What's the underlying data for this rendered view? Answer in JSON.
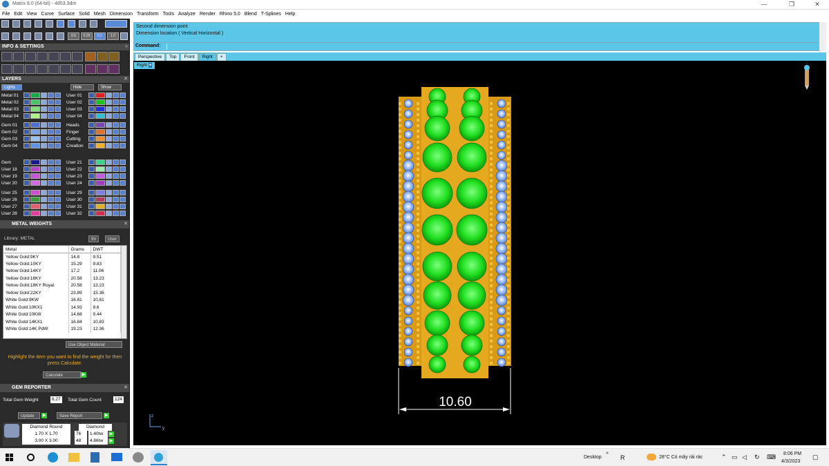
{
  "window": {
    "title": "Matrix 8.0 (64-bit) - 4853.3dm",
    "min_glyph": "—",
    "max_glyph": "❐",
    "close_glyph": "✕"
  },
  "menu": [
    "File",
    "Edit",
    "View",
    "Curve",
    "Surface",
    "Solid",
    "Mesh",
    "Dimension",
    "Transform",
    "Tools",
    "Analyze",
    "Render",
    "Rhino 5.0",
    "Blend",
    "T-Splines",
    "Help"
  ],
  "toolbar": {
    "values": [
      "0.5",
      "0.25",
      "0.1",
      "1.0"
    ]
  },
  "info": {
    "title": "INFO & SETTINGS"
  },
  "layers": {
    "title": "LAYERS",
    "lights_label": "Lights",
    "hide_label": "Hide",
    "show_label": "Show",
    "rows_left": [
      "Metal 01",
      "Metal 02",
      "Metal 03",
      "Metal 04",
      "Gem 01",
      "Gem 02",
      "Gem 03",
      "Gem 04",
      "Gem",
      "User 18",
      "User 19",
      "User 20",
      "User 25",
      "User 26",
      "User 27",
      "User 28"
    ],
    "rows_right": [
      "User 01",
      "User 02",
      "User 03",
      "User 04",
      "Heads",
      "Finger",
      "Cutting",
      "Creation",
      "User 21",
      "User 22",
      "User 23",
      "User 24",
      "User 29",
      "User 30",
      "User 31",
      "User 32"
    ],
    "colors_left": [
      "#18a94b",
      "#4cc36a",
      "#7ee07a",
      "#b2f28a",
      "#4d6fd4",
      "#7da2e2",
      "#9bc2ee",
      "#5b93e6",
      "#1a1a8a",
      "#b745c8",
      "#c954d8",
      "#d66ce4",
      "#cf4ecf",
      "#3d9a3d",
      "#e06070",
      "#e040a0"
    ],
    "colors_right": [
      "#e02020",
      "#20c020",
      "#2030e0",
      "#30c0d0",
      "#7a46b6",
      "#e07030",
      "#e89030",
      "#f0b030",
      "#3bd68e",
      "#9ee8b0",
      "#c060e0",
      "#a040c0",
      "#8080e0",
      "#b04060",
      "#e0b030",
      "#d03050"
    ]
  },
  "metal_weights": {
    "title": "METAL WEIGHTS",
    "library_label": "Library: METAL",
    "btn_9": "9V",
    "btn_user": "User",
    "headers": [
      "Metal",
      "Grams",
      "DWT"
    ],
    "rows": [
      [
        "Yellow Gold:9KY",
        "14.8",
        "9.51"
      ],
      [
        "Yellow Gold:10KY",
        "15.29",
        "9.83"
      ],
      [
        "Yellow Gold:14KY",
        "17.2",
        "11.06"
      ],
      [
        "Yellow Gold:18KY",
        "20.58",
        "13.23"
      ],
      [
        "Yellow Gold:18KY Royal",
        "20.58",
        "13.23"
      ],
      [
        "Yellow Gold:22KY",
        "23.89",
        "15.36"
      ],
      [
        "White Gold:9KW",
        "16.81",
        "10.81"
      ],
      [
        "White Gold:10KX1",
        "14.93",
        "9.6"
      ],
      [
        "White Gold:10KW",
        "14.68",
        "9.44"
      ],
      [
        "White Gold:14KX1",
        "16.84",
        "10.83"
      ],
      [
        "White Gold:14K PdW",
        "19.23",
        "12.36"
      ]
    ],
    "use_object": "Use Object Material",
    "instruction": "Highlight the item you want to find the weight for then press Calculate.",
    "calculate": "Calculate"
  },
  "gem_reporter": {
    "title": "GEM REPORTER",
    "total_weight_label": "Total Gem Weight",
    "total_weight": "6.27",
    "total_count_label": "Total Gem Count",
    "total_count": "124",
    "update": "Update",
    "save_report": "Save Report",
    "shape": "Diamond Round",
    "type": "Diamond",
    "rows": [
      [
        "1.70 X 1.70",
        "76",
        "1.40tw"
      ],
      [
        "3.00 X 3.00",
        "48",
        "4.86tw"
      ]
    ]
  },
  "command": {
    "line1": "Second dimension point",
    "line2": "Dimension location ( Vertical  Horizontal )",
    "label": "Command:"
  },
  "view_tabs": [
    "Perspective",
    "Top",
    "Front",
    "Right",
    "+"
  ],
  "viewport": {
    "label": "Right",
    "dimension": "10.60",
    "axis_z": "z",
    "axis_y": "y"
  },
  "colors": {
    "gold": "#e0a21a",
    "gem_green": "#22e022",
    "side_gem": "#8fb0ee",
    "cmd_blue": "#5bc6e8"
  },
  "taskbar": {
    "desktop": "Desktop",
    "weather": "28°C  Có mây rải rác",
    "time": "8:06 PM",
    "date": "4/3/2023",
    "user": "R"
  }
}
